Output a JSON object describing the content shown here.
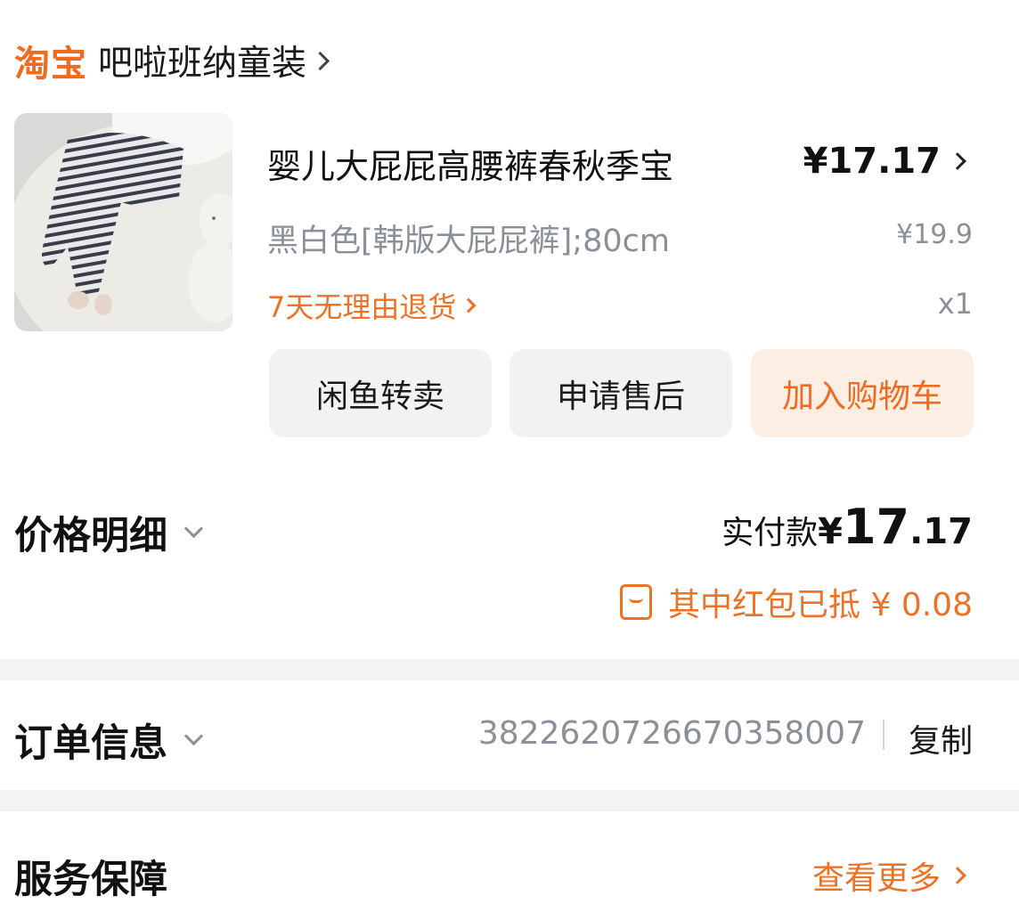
{
  "shop": {
    "platform_logo": "淘宝",
    "name": "吧啦班纳童装"
  },
  "item": {
    "title": "婴儿大屁屁高腰裤春秋季宝",
    "price": "¥17.17",
    "sku": "黑白色[韩版大屁屁裤];80cm",
    "original_price": "¥19.9",
    "returns_policy": "7天无理由退货",
    "quantity": "x1"
  },
  "actions": {
    "resell": "闲鱼转卖",
    "after_sales": "申请售后",
    "add_to_cart": "加入购物车"
  },
  "price_detail": {
    "label": "价格明细",
    "paid_label": "实付款",
    "paid_currency": "¥",
    "paid_integer": "17",
    "paid_decimal": ".17",
    "hongbao_text": "其中红包已抵 ¥ 0.08"
  },
  "order_info": {
    "label": "订单信息",
    "order_number": "3822620726670358007",
    "copy_label": "复制"
  },
  "service": {
    "label": "服务保障",
    "see_more": "查看更多"
  },
  "colors": {
    "accent": "#ee7225",
    "muted": "#8a8f98",
    "button_bg": "#f1f2f4",
    "cart_bg": "#fdeee3"
  },
  "icons": [
    "chevron-right-icon",
    "chevron-down-icon",
    "red-packet-icon"
  ]
}
